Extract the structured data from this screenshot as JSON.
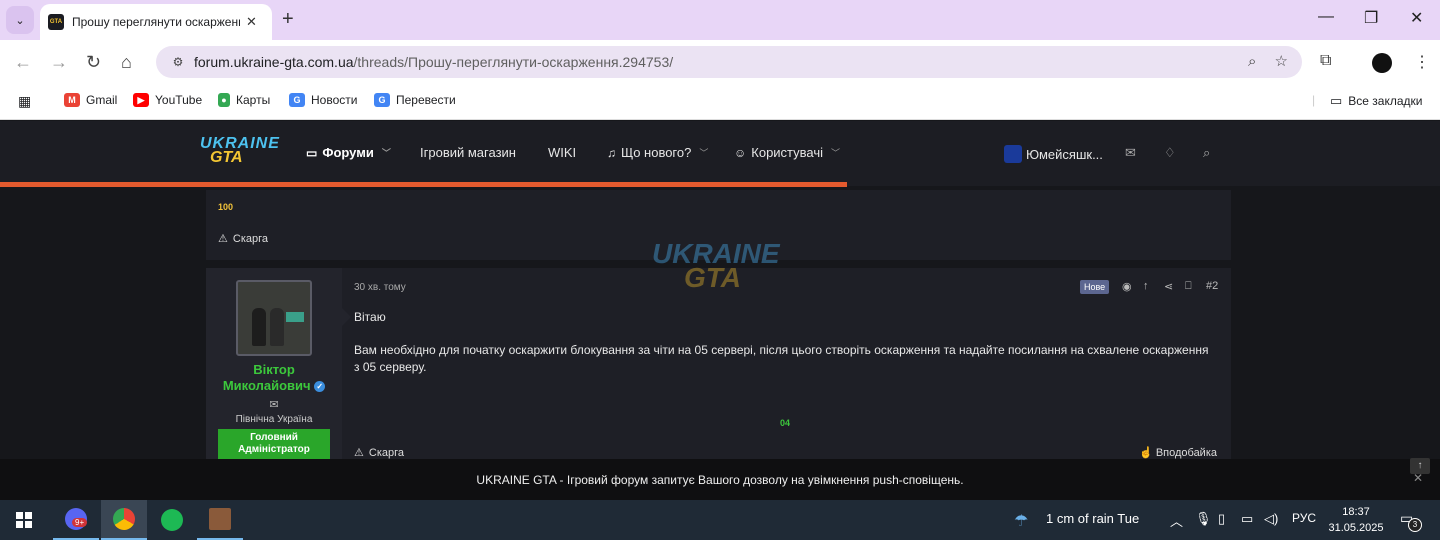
{
  "browser": {
    "tab_title": "Прошу переглянути оскарження",
    "tab_close": "✕",
    "new_tab": "+",
    "url_domain": "forum.ukraine-gta.com.ua",
    "url_path": "/threads/Прошу-переглянути-оскарження.294753/",
    "window_controls": [
      "—",
      "❐",
      "✕"
    ]
  },
  "bookmarks": {
    "items": [
      {
        "label": "Gmail",
        "icon": "gmail-icon",
        "color": "#ea4335"
      },
      {
        "label": "YouTube",
        "icon": "youtube-icon",
        "color": "#ff0000"
      },
      {
        "label": "Карты",
        "icon": "maps-icon",
        "color": "#34a853"
      },
      {
        "label": "Новости",
        "icon": "news-icon",
        "color": "#4285f4"
      },
      {
        "label": "Перевести",
        "icon": "translate-icon",
        "color": "#4285f4"
      }
    ],
    "all_bookmarks": "Все закладки"
  },
  "forum": {
    "logo_line1": "UKRAINE",
    "logo_line2": "GTA",
    "nav": [
      {
        "label": "Форуми"
      },
      {
        "label": "Ігровий магазин"
      },
      {
        "label": "WIKI"
      },
      {
        "label": "Що нового?"
      },
      {
        "label": "Користувачі"
      }
    ],
    "username_short": "Юмейсяшк...",
    "progress_fraction": 0.588
  },
  "prev_post": {
    "value": "100",
    "report": "Скарга"
  },
  "post": {
    "time": "30 хв. тому",
    "badge": "Нове",
    "number": "#2",
    "author_line1": "Віктор",
    "author_line2": "Миколайович",
    "region": "Північна Україна",
    "role_line1": "Головний",
    "role_line2": "Адміністратор",
    "greeting": "Вітаю",
    "body": "Вам необхідно для початку оскаржити блокування за чіти на 05 сервері, після цього створіть оскарження та надайте посилання на схвалене оскарження з 05 серверу.",
    "signature": "04",
    "report": "Скарга",
    "like": "Вподобайка"
  },
  "push_banner": {
    "text": "UKRAINE GTA - Ігровий форум запитує Вашого дозволу на увімкнення push-сповіщень."
  },
  "taskbar": {
    "discord_badge": "9+",
    "weather": "1 cm of rain Tue",
    "language": "РУС",
    "time": "18:37",
    "date": "31.05.2025",
    "notifications": "3"
  }
}
